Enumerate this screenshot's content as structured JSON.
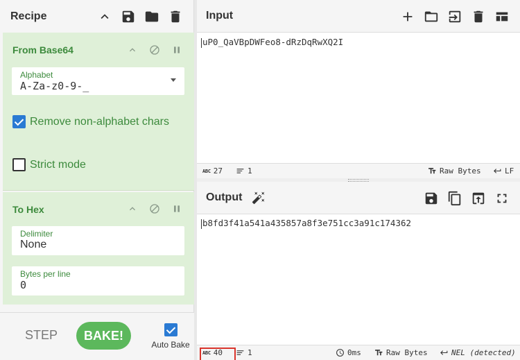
{
  "recipe": {
    "title": "Recipe",
    "operations": [
      {
        "name": "From Base64",
        "alphabet_label": "Alphabet",
        "alphabet_value": "A-Za-z0-9-_",
        "remove_label": "Remove non-alphabet chars",
        "remove_checked": true,
        "strict_label": "Strict mode",
        "strict_checked": false
      },
      {
        "name": "To Hex",
        "delimiter_label": "Delimiter",
        "delimiter_value": "None",
        "bytes_label": "Bytes per line",
        "bytes_value": "0"
      }
    ],
    "step_label": "STEP",
    "bake_label": "BAKE!",
    "autobake_label": "Auto Bake",
    "autobake_checked": true
  },
  "input": {
    "title": "Input",
    "text": "uP0_QaVBpDWFeo8-dRzDqRwXQ2I",
    "status": {
      "abc": "ABC",
      "length": "27",
      "lines": "1",
      "encoding": "Raw Bytes",
      "eol": "LF"
    }
  },
  "output": {
    "title": "Output",
    "text": "b8fd3f41a541a435857a8f3e751cc3a91c174362",
    "status": {
      "abc": "ABC",
      "length": "40",
      "lines": "1",
      "time": "0ms",
      "encoding": "Raw Bytes",
      "eol": "NEL (detected)"
    }
  },
  "colors": {
    "accent_green": "#5cb85c",
    "operation_bg": "#dff0d8",
    "highlight_box": "#d9342b",
    "checkbox_blue": "#2a7ad3"
  }
}
